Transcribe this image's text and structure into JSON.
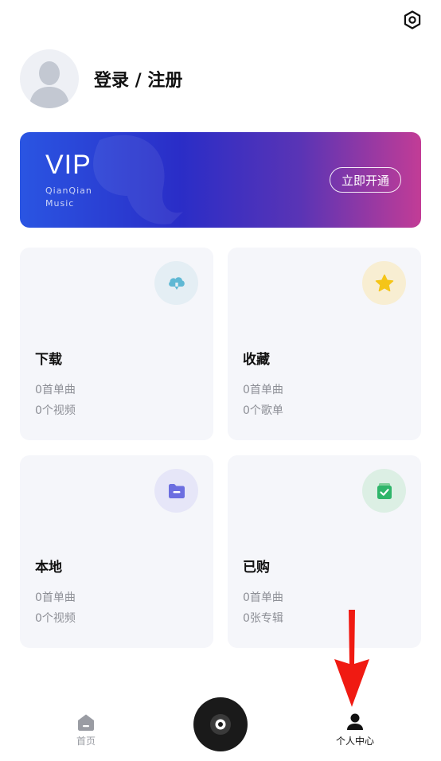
{
  "profile": {
    "login_text": "登录 / 注册"
  },
  "vip": {
    "title": "VIP",
    "sub1": "QianQian",
    "sub2": "Music",
    "button": "立即开通"
  },
  "cards": [
    {
      "title": "下载",
      "line1": "0首单曲",
      "line2": "0个视频",
      "icon": "cloud-download-icon",
      "icon_bg": "#e4eef4"
    },
    {
      "title": "收藏",
      "line1": "0首单曲",
      "line2": "0个歌单",
      "icon": "star-icon",
      "icon_bg": "#f8eed2"
    },
    {
      "title": "本地",
      "line1": "0首单曲",
      "line2": "0个视频",
      "icon": "folder-icon",
      "icon_bg": "#e6e6f8"
    },
    {
      "title": "已购",
      "line1": "0首单曲",
      "line2": "0张专辑",
      "icon": "purchased-icon",
      "icon_bg": "#dcefe4"
    }
  ],
  "tabbar": {
    "home_label": "首页",
    "me_label": "个人中心"
  },
  "colors": {
    "accent_red": "#f01a12",
    "tab_inactive": "#9a9ca3",
    "tab_active": "#111111"
  }
}
